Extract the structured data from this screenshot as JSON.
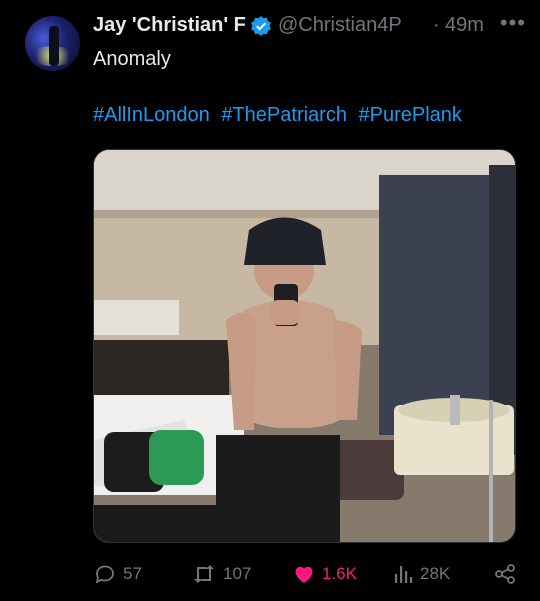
{
  "tweet": {
    "author_name": "Jay 'Christian' F",
    "author_handle": "@Christian4P",
    "separator": "·",
    "time_ago": "49m",
    "more_label": "•••",
    "text": "Anomaly",
    "hashtags": [
      "#AllInLondon",
      "#ThePatriarch",
      "#PurePlank"
    ]
  },
  "actions": {
    "replies": "57",
    "reposts": "107",
    "likes": "1.6K",
    "views": "28K"
  },
  "colors": {
    "background": "#000000",
    "text": "#e7e9ea",
    "muted": "#71767b",
    "link": "#1d9bf0",
    "like": "#f91880",
    "verified": "#1d9bf0"
  },
  "icons": [
    "verified-icon",
    "more-icon",
    "reply-icon",
    "repost-icon",
    "heart-icon",
    "views-icon",
    "share-icon"
  ]
}
